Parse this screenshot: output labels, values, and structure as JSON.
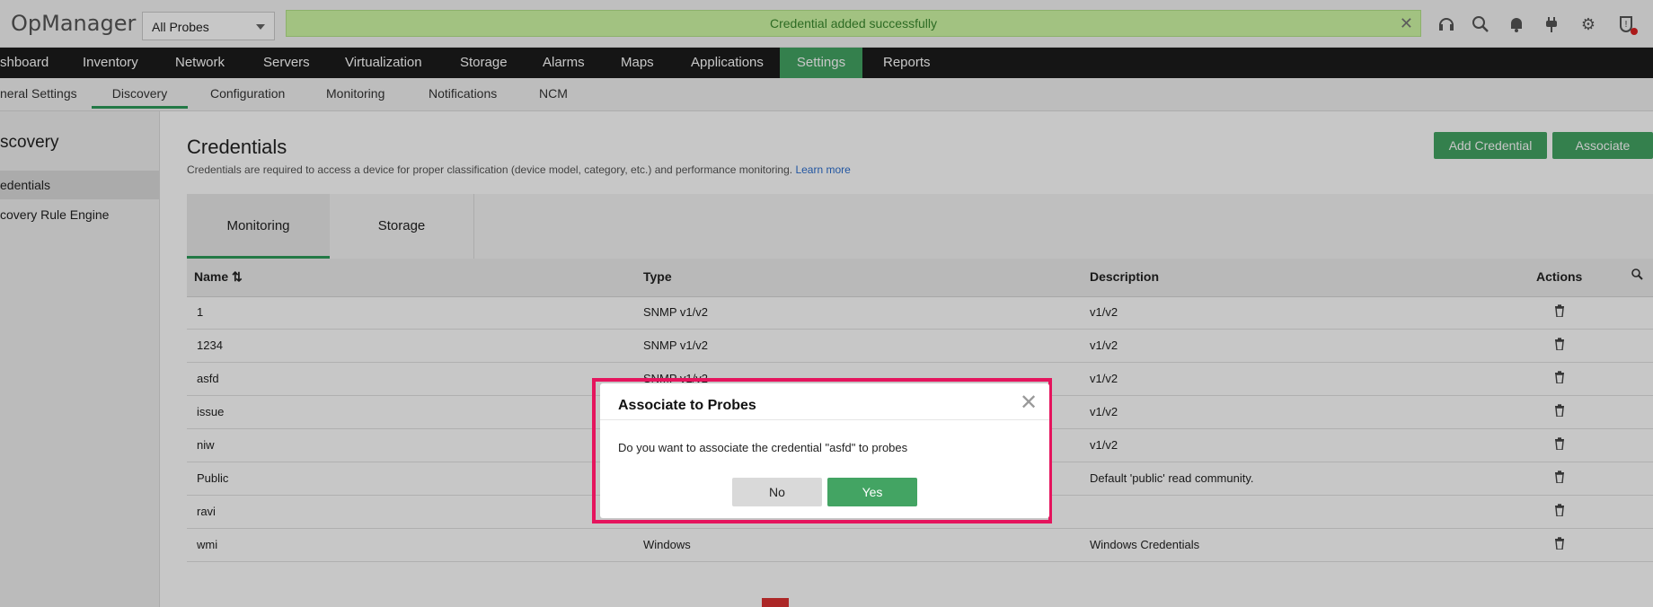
{
  "header": {
    "logo": "OpManager",
    "probe_select": "All Probes",
    "toast": "Credential added successfully",
    "icons": [
      "headset-icon",
      "search-icon",
      "bell-icon",
      "plug-icon",
      "gear-icon",
      "alert-shield-icon"
    ]
  },
  "main_nav": [
    "shboard",
    "Inventory",
    "Network",
    "Servers",
    "Virtualization",
    "Storage",
    "Alarms",
    "Maps",
    "Applications",
    "Settings",
    "Reports"
  ],
  "main_nav_active": "Settings",
  "sub_nav": [
    "neral Settings",
    "Discovery",
    "Configuration",
    "Monitoring",
    "Notifications",
    "NCM"
  ],
  "sub_nav_active": "Discovery",
  "sidebar": {
    "title": "scovery",
    "items": [
      "edentials",
      "covery Rule Engine"
    ]
  },
  "content": {
    "title": "Credentials",
    "description": "Credentials are required to access a device for proper classification (device model, category, etc.) and performance monitoring.",
    "learn_more": "Learn more",
    "add_button": "Add Credential",
    "associate_button": "Associate",
    "tabs": [
      "Monitoring",
      "Storage"
    ],
    "columns": {
      "name": "Name",
      "type": "Type",
      "description": "Description",
      "actions": "Actions"
    },
    "rows": [
      {
        "name": "1",
        "type": "SNMP v1/v2",
        "description": "v1/v2"
      },
      {
        "name": "1234",
        "type": "SNMP v1/v2",
        "description": "v1/v2"
      },
      {
        "name": "asfd",
        "type": "SNMP v1/v2",
        "description": "v1/v2"
      },
      {
        "name": "issue",
        "type": "",
        "description": "v1/v2"
      },
      {
        "name": "niw",
        "type": "",
        "description": "v1/v2"
      },
      {
        "name": "Public",
        "type": "",
        "description": "Default 'public' read community."
      },
      {
        "name": "ravi",
        "type": "",
        "description": ""
      },
      {
        "name": "wmi",
        "type": "Windows",
        "description": "Windows Credentials"
      }
    ]
  },
  "modal": {
    "title": "Associate to Probes",
    "body": "Do you want to associate the credential \"asfd\" to probes",
    "no": "No",
    "yes": "Yes"
  }
}
